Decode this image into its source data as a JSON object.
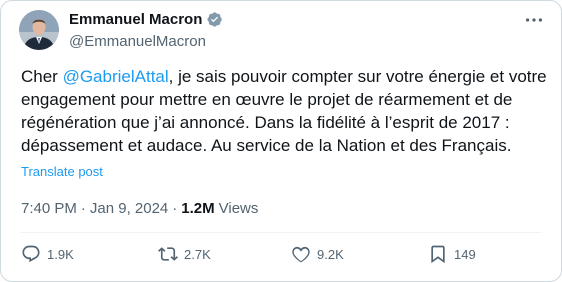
{
  "author": {
    "name": "Emmanuel Macron",
    "handle": "@EmmanuelMacron",
    "verified_color": "#829aab"
  },
  "tweet": {
    "text_prefix": "Cher ",
    "mention": "@GabrielAttal",
    "text_body": ", je sais pouvoir compter sur votre énergie et votre engagement pour mettre en œuvre le projet de réarmement et de régénération que j’ai annoncé. Dans la fidélité à l’esprit de 2017 : dépassement et audace. Au service de la Nation et des Français.",
    "translate_label": "Translate post"
  },
  "meta": {
    "time": "7:40 PM",
    "separator": "·",
    "date": "Jan 9, 2024",
    "views_count": "1.2M",
    "views_label": "Views"
  },
  "actions": {
    "replies": "1.9K",
    "reposts": "2.7K",
    "likes": "9.2K",
    "bookmarks": "149"
  },
  "colors": {
    "link": "#1d9bf0",
    "secondary": "#536471",
    "border": "#cfd9de"
  }
}
